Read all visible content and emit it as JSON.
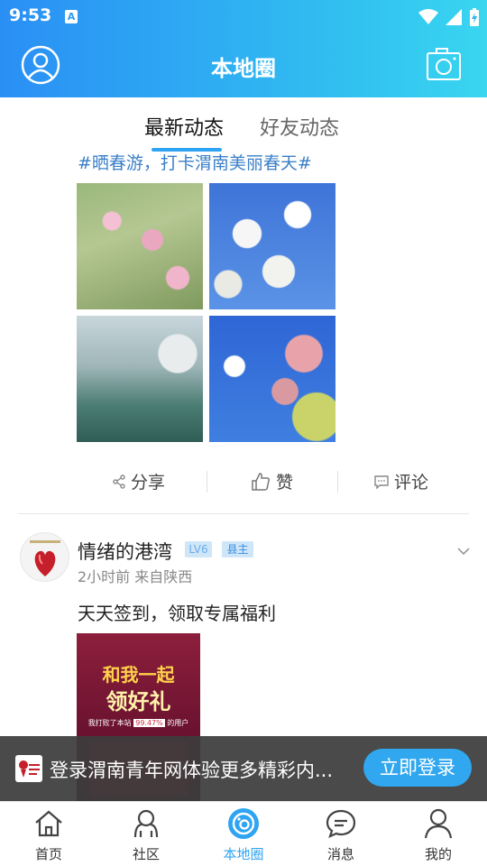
{
  "status_bar": {
    "time": "9:53",
    "notification_icon": "A"
  },
  "header": {
    "title": "本地圈",
    "left_icon": "user-avatar-icon",
    "right_icon": "camera-icon"
  },
  "tabs": [
    {
      "label": "最新动态",
      "active": true
    },
    {
      "label": "好友动态",
      "active": false
    }
  ],
  "post1": {
    "hashtag": "#晒春游，打卡渭南美丽春天#",
    "images": [
      "peach-blossom-photo",
      "white-blossom-sky-photo",
      "lake-blossom-photo",
      "pink-blossom-sky-photo"
    ],
    "actions": {
      "share": "分享",
      "like": "赞",
      "comment": "评论"
    }
  },
  "post2": {
    "username": "情绪的港湾",
    "level": "LV6",
    "role": "县主",
    "meta": "2小时前  来自陕西",
    "text": "天天签到，领取专属福利",
    "promo": {
      "line1": "和我一起",
      "line2": "领好礼",
      "line3_prefix": "我打败了本站",
      "line3_value": "99.47%",
      "line3_suffix": "的用户"
    }
  },
  "login_bar": {
    "text": "登录渭南青年网体验更多精彩内...",
    "button": "立即登录"
  },
  "bottom_nav": [
    {
      "label": "首页",
      "icon": "home-icon"
    },
    {
      "label": "社区",
      "icon": "community-icon"
    },
    {
      "label": "本地圈",
      "icon": "local-circle-icon",
      "active": true
    },
    {
      "label": "消息",
      "icon": "message-icon"
    },
    {
      "label": "我的",
      "icon": "profile-icon"
    }
  ],
  "colors": {
    "accent": "#2ea4f2",
    "header_start": "#2a8ff5",
    "header_end": "#39d6f0",
    "hashtag": "#3a7fc8"
  }
}
